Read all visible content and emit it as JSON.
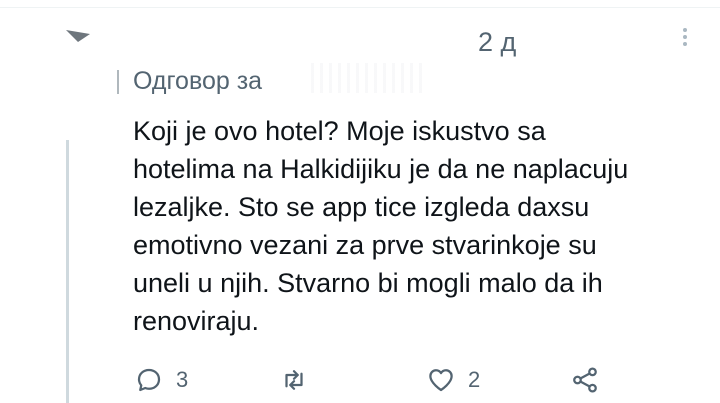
{
  "header": {
    "timestamp": "2 д",
    "more_icon": "more-vertical-icon"
  },
  "reply": {
    "label": "Одговор за"
  },
  "tweet": {
    "text": "Koji je ovo hotel? Moje iskustvo sa\nhotelima na Halkidijiku je da ne naplacuju\nlezaljke. Sto se app tice izgleda daxsu\nemotivno vezani za prve stvarinkoje su\nuneli u njih. Stvarno bi mogli malo da ih\nrenoviraju."
  },
  "actions": {
    "reply": {
      "icon": "comment-icon",
      "count": "3"
    },
    "retweet": {
      "icon": "retweet-icon",
      "count": ""
    },
    "like": {
      "icon": "heart-icon",
      "count": "2"
    },
    "share": {
      "icon": "share-icon",
      "count": ""
    }
  },
  "colors": {
    "text": "#0f1419",
    "secondary": "#536471",
    "thread_line": "#cfd9de"
  }
}
